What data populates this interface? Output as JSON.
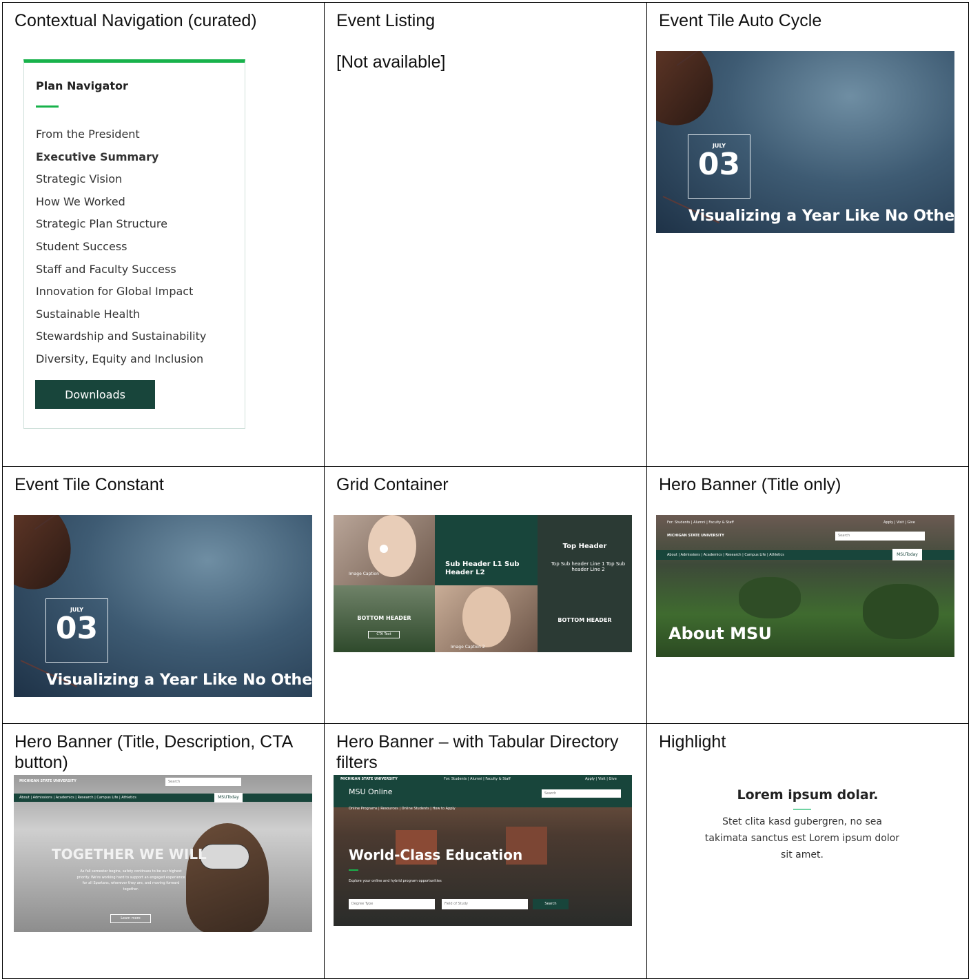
{
  "cells": {
    "contextual_nav": {
      "title": "Contextual Navigation (curated)",
      "card_title": "Plan Navigator",
      "items": [
        "From the President",
        "Executive Summary",
        "Strategic Vision",
        "How We Worked",
        "Strategic Plan Structure",
        "Student Success",
        "Staff and Faculty Success",
        "Innovation for Global Impact",
        "Sustainable Health",
        "Stewardship and Sustainability",
        "Diversity, Equity and Inclusion"
      ],
      "active_item": "Executive Summary",
      "button": "Downloads"
    },
    "event_listing": {
      "title": "Event Listing",
      "text": "[Not available]"
    },
    "event_tile_auto": {
      "title": "Event Tile Auto Cycle",
      "month": "JULY",
      "day": "03",
      "headline": "Visualizing a Year Like No Other"
    },
    "event_tile_constant": {
      "title": "Event Tile Constant",
      "month": "JULY",
      "day": "03",
      "headline": "Visualizing a Year Like No Other"
    },
    "grid_container": {
      "title": "Grid Container",
      "image_caption": "Image Caption",
      "image_caption_2": "Image Caption 2",
      "sub_header": "Sub Header L1 Sub Header L2",
      "top_header": "Top Header",
      "top_sub": "Top Sub header Line 1 Top Sub header Line 2",
      "bottom_header": "BOTTOM HEADER",
      "bottom_header_right": "BOTTOM HEADER",
      "cta": "CTA Text"
    },
    "hero_title_only": {
      "title": "Hero Banner (Title only)",
      "audience": "For: Students | Alumni | Faculty & Staff",
      "utility": "Apply | Visit | Give",
      "brand": "MICHIGAN STATE UNIVERSITY",
      "search": "Search",
      "nav": "About | Admissions | Academics | Research | Campus Life | Athletics",
      "today": "MSUToday",
      "headline": "About MSU"
    },
    "hero_cta": {
      "title": "Hero Banner (Title, Description, CTA button)",
      "brand": "MICHIGAN STATE UNIVERSITY",
      "search": "Search",
      "nav": "About | Admissions | Academics | Research | Campus Life | Athletics",
      "today": "MSUToday",
      "headline": "TOGETHER WE WILL",
      "description": "As fall semester begins, safety continues to be our highest priority. We're working hard to support an engaged experience for all Spartans, wherever they are, and moving forward together.",
      "cta": "Learn more"
    },
    "hero_filters": {
      "title": "Hero Banner – with Tabular Directory filters",
      "brand": "MICHIGAN STATE UNIVERSITY",
      "audience": "For: Students | Alumni | Faculty & Staff",
      "utility": "Apply | Visit | Give",
      "site": "MSU Online",
      "search": "Search",
      "nav": "Online Programs | Resources | Online Students | How to Apply",
      "headline": "World-Class Education",
      "sub": "Explore your online and hybrid program opportunities",
      "filter1": "Degree Type",
      "filter2": "Field of Study",
      "search_btn": "Search"
    },
    "highlight": {
      "title": "Highlight",
      "heading": "Lorem ipsum dolar.",
      "body": "Stet clita kasd gubergren, no sea takimata sanctus est Lorem ipsum dolor sit amet."
    }
  },
  "colors": {
    "msu_green": "#18453b",
    "accent_green": "#18b24b",
    "highlight_rule": "#6fd3a2"
  }
}
